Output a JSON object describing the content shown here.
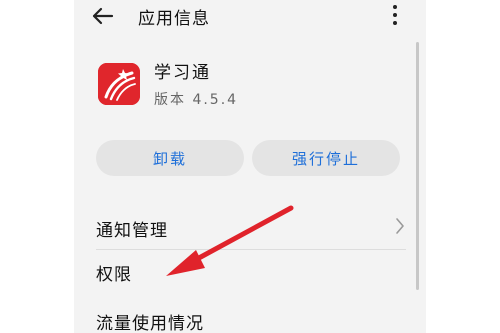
{
  "header": {
    "title": "应用信息",
    "back_icon": "back-arrow-icon",
    "more_icon": "more-vertical-icon"
  },
  "app": {
    "name": "学习通",
    "version": "版本 4.5.4",
    "icon": "xuexitong-app-icon",
    "icon_color": "#e0262c"
  },
  "actions": {
    "uninstall_label": "卸载",
    "force_stop_label": "强行停止",
    "accent_color": "#1e6fd9"
  },
  "settings": {
    "items": [
      {
        "label": "通知管理",
        "has_chevron": true
      },
      {
        "label": "权限"
      },
      {
        "label": "流量使用情况"
      }
    ]
  },
  "annotation": {
    "arrow_color": "#e0232b",
    "points_to": "权限"
  }
}
